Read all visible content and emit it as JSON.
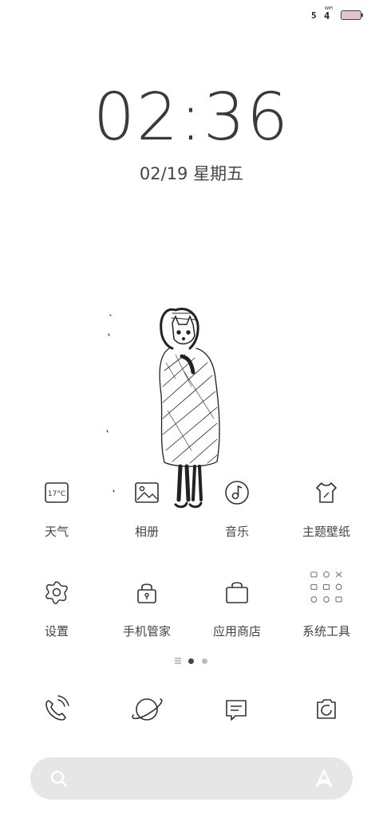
{
  "status_bar": {
    "signal_text": "5",
    "wifi_label": "WiFi",
    "wifi_glyph": "4",
    "battery_color": "#e3c3cd"
  },
  "clock": {
    "time": "02:36",
    "date": "02/19 星期五"
  },
  "apps": [
    {
      "label": "天气",
      "icon": "weather-icon",
      "icon_text": "17°C"
    },
    {
      "label": "相册",
      "icon": "gallery-icon"
    },
    {
      "label": "音乐",
      "icon": "music-icon"
    },
    {
      "label": "主题壁纸",
      "icon": "theme-icon"
    },
    {
      "label": "设置",
      "icon": "settings-icon"
    },
    {
      "label": "手机管家",
      "icon": "phone-manager-icon"
    },
    {
      "label": "应用商店",
      "icon": "app-store-icon"
    },
    {
      "label": "系统工具",
      "icon": "system-tools-folder-icon"
    }
  ],
  "page_indicator": {
    "pages": 2,
    "active": 0
  },
  "dock": [
    {
      "icon": "phone-icon"
    },
    {
      "icon": "browser-icon"
    },
    {
      "icon": "messages-icon"
    },
    {
      "icon": "camera-icon"
    }
  ],
  "search": {
    "icon": "search-icon",
    "voice_icon": "voice-assistant-icon",
    "bar_color": "#e6e6e6"
  }
}
